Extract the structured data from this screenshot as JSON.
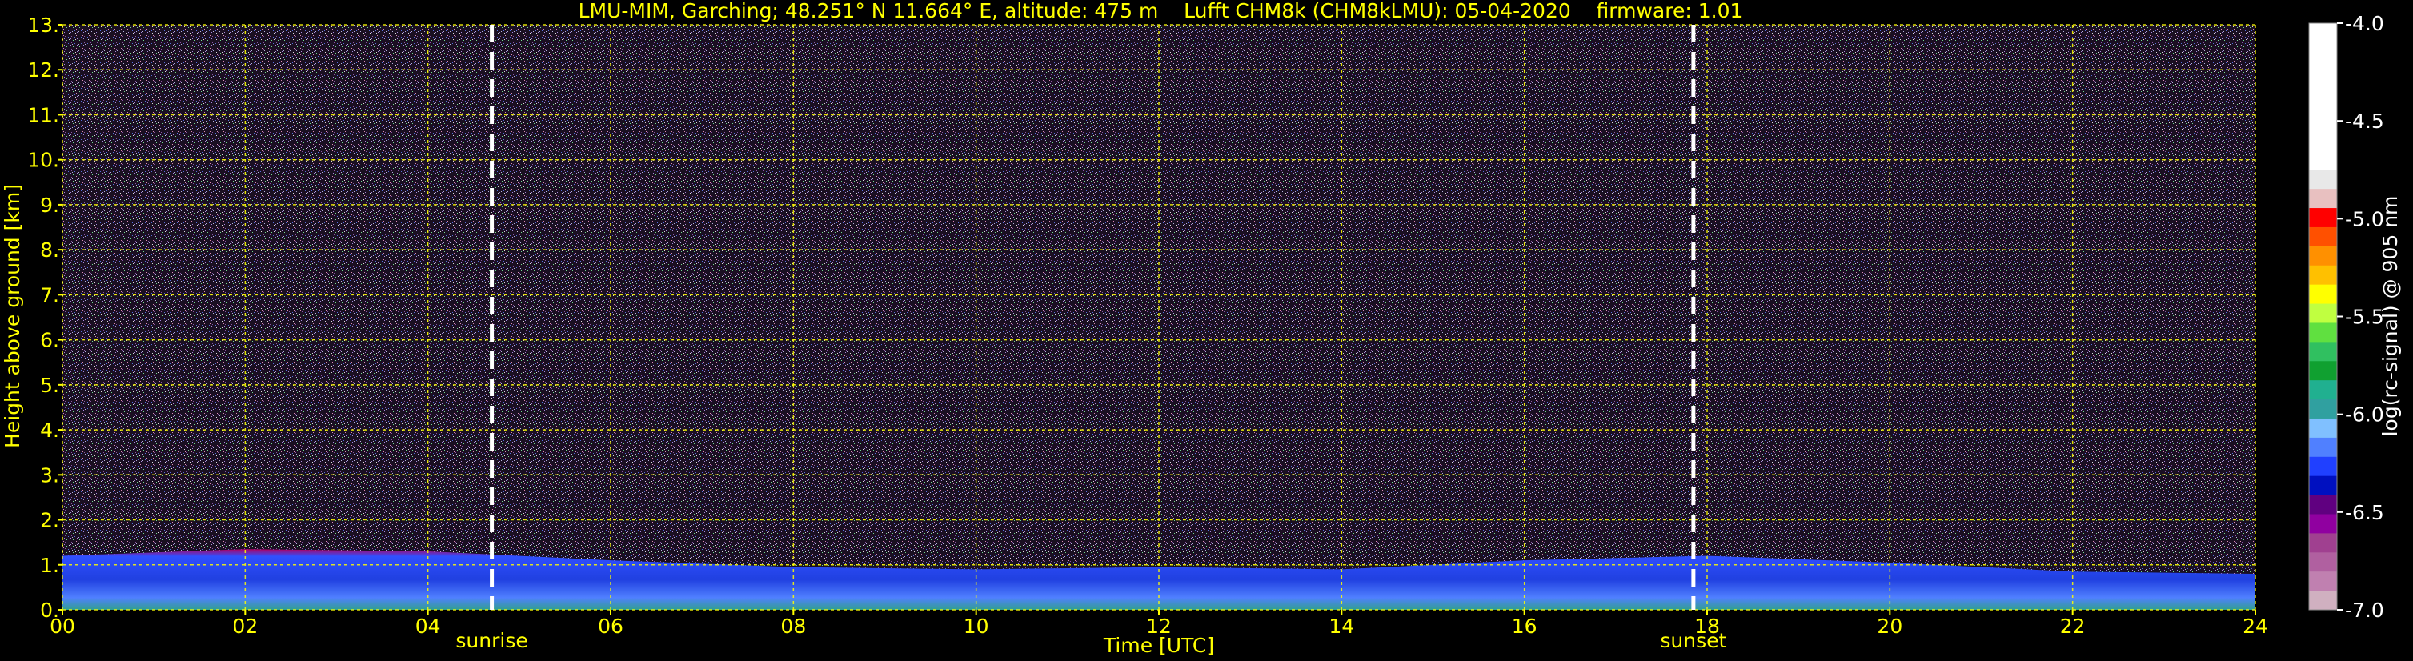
{
  "chart_data": {
    "type": "heatmap",
    "title": "LMU-MIM, Garching; 48.251° N 11.664° E, altitude: 475 m    Lufft CHM8k (CHM8kLMU): 05-04-2020    firmware: 1.01",
    "xlabel": "Time [UTC]",
    "ylabel": "Height above ground [km]",
    "colorbar_label": "log(rc-signal) @ 905 nm",
    "xlim": [
      0,
      24
    ],
    "ylim": [
      0,
      13
    ],
    "clim": [
      -7.0,
      -4.0
    ],
    "x_ticks": [
      0,
      2,
      4,
      6,
      8,
      10,
      12,
      14,
      16,
      18,
      20,
      22,
      24
    ],
    "x_tick_labels": [
      "00",
      "02",
      "04",
      "06",
      "08",
      "10",
      "12",
      "14",
      "16",
      "18",
      "20",
      "22",
      "24"
    ],
    "y_ticks": [
      0,
      1,
      2,
      3,
      4,
      5,
      6,
      7,
      8,
      9,
      10,
      11,
      12,
      13
    ],
    "y_tick_labels": [
      "0.",
      "1.",
      "2.",
      "3.",
      "4.",
      "5.",
      "6.",
      "7.",
      "8.",
      "9.",
      "10.",
      "11.",
      "12.",
      "13."
    ],
    "colorbar_ticks": [
      -4.0,
      -4.5,
      -5.0,
      -5.5,
      -6.0,
      -6.5,
      -7.0
    ],
    "colorbar_tick_labels": [
      "-4.0",
      "-4.5",
      "-5.0",
      "-5.5",
      "-6.0",
      "-6.5",
      "-7.0"
    ],
    "grid": true,
    "grid_color": "#ffff00",
    "text_color": "#ffff00",
    "background": "#000000",
    "markers": [
      {
        "label": "sunrise",
        "x": 4.7
      },
      {
        "label": "sunset",
        "x": 17.85
      }
    ],
    "boundary_layer_top_km": [
      {
        "x": 0,
        "y": 1.2
      },
      {
        "x": 2,
        "y": 1.35
      },
      {
        "x": 4,
        "y": 1.3
      },
      {
        "x": 6,
        "y": 1.1
      },
      {
        "x": 8,
        "y": 0.95
      },
      {
        "x": 10,
        "y": 0.9
      },
      {
        "x": 12,
        "y": 0.95
      },
      {
        "x": 14,
        "y": 0.9
      },
      {
        "x": 16,
        "y": 1.1
      },
      {
        "x": 18,
        "y": 1.2
      },
      {
        "x": 20,
        "y": 1.05
      },
      {
        "x": 22,
        "y": 0.85
      },
      {
        "x": 24,
        "y": 0.8
      }
    ],
    "colormap": [
      "#ffffff",
      "#e8e8e8",
      "#e8c0c0",
      "#ff0000",
      "#ff5000",
      "#ff9000",
      "#ffc000",
      "#ffff00",
      "#c0ff40",
      "#60e040",
      "#30c060",
      "#10a030",
      "#20b090",
      "#30a0a0",
      "#80c0ff",
      "#5080ff",
      "#2040ff",
      "#0010c0",
      "#600080",
      "#9000a0",
      "#a04090",
      "#b060a0",
      "#c080b0",
      "#d0b0c0"
    ]
  }
}
